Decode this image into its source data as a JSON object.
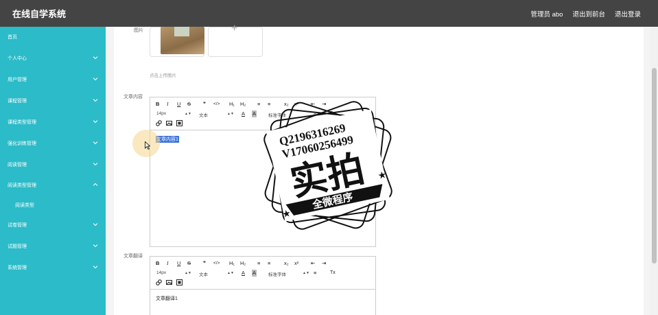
{
  "header": {
    "title": "在线自学系统",
    "admin": "管理员 abo",
    "back_to_front": "退出到前台",
    "logout": "退出登录"
  },
  "sidebar": {
    "items": [
      {
        "label": "首页"
      },
      {
        "label": "个人中心"
      },
      {
        "label": "用户管理"
      },
      {
        "label": "课程管理"
      },
      {
        "label": "课程类型管理"
      },
      {
        "label": "强化训练管理"
      },
      {
        "label": "阅读管理"
      },
      {
        "label": "阅读类型管理"
      },
      {
        "label": "阅读类型"
      },
      {
        "label": "试卷管理"
      },
      {
        "label": "试题管理"
      },
      {
        "label": "系统管理"
      }
    ]
  },
  "form": {
    "image_label": "图片",
    "upload_hint": "点击上传图片",
    "content_label": "文章内容",
    "translation_label": "文章翻译"
  },
  "editor_toolbar": {
    "bold": "B",
    "italic": "I",
    "underline": "U",
    "strike": "S",
    "quote": "❞",
    "code": "</>",
    "h1": "H₁",
    "h2": "H₂",
    "ordered_list": "≡",
    "bullet_list": "≡",
    "subscript": "x₂",
    "superscript": "x²",
    "outdent": "⇤",
    "indent": "⇥",
    "font_size": "14px",
    "text_type": "文本",
    "font_color": "A",
    "bg_color": "A",
    "font_family": "标准字体",
    "align": "≡",
    "clear": "Tx"
  },
  "editor_content": {
    "content_value": "文章内容1",
    "translation_value": "文章翻译1"
  },
  "watermark": {
    "line1": "Q2196316269",
    "line2": "V17060256499",
    "main": "实拍",
    "banner": "全微程序"
  }
}
